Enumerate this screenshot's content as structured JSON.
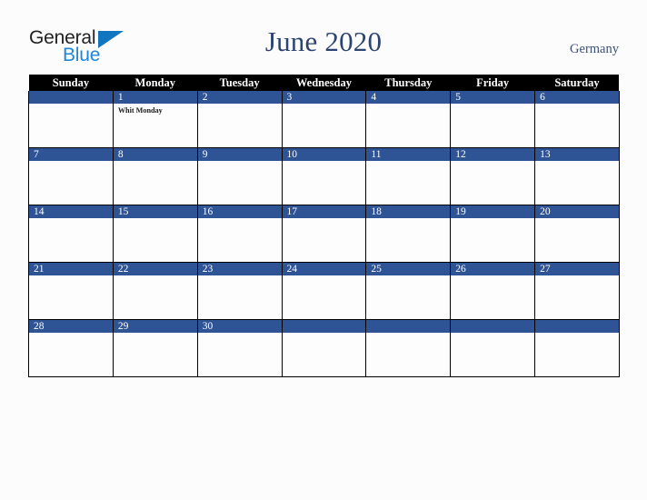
{
  "brand": {
    "word_one": "General",
    "word_two": "Blue"
  },
  "header": {
    "title": "June 2020",
    "country": "Germany"
  },
  "calendar": {
    "weekday_headers": [
      "Sunday",
      "Monday",
      "Tuesday",
      "Wednesday",
      "Thursday",
      "Friday",
      "Saturday"
    ],
    "colors": {
      "header_bar": "#000000",
      "date_bar": "#2f5496",
      "title": "#2d4470",
      "country": "#3c5077",
      "brand_blue": "#1f87d8",
      "page_background": "#fcfcfc",
      "cell_background": "#fdfdfd"
    },
    "weeks": [
      [
        {
          "date": "",
          "events": []
        },
        {
          "date": "1",
          "events": [
            "Whit Monday"
          ]
        },
        {
          "date": "2",
          "events": []
        },
        {
          "date": "3",
          "events": []
        },
        {
          "date": "4",
          "events": []
        },
        {
          "date": "5",
          "events": []
        },
        {
          "date": "6",
          "events": []
        }
      ],
      [
        {
          "date": "7",
          "events": []
        },
        {
          "date": "8",
          "events": []
        },
        {
          "date": "9",
          "events": []
        },
        {
          "date": "10",
          "events": []
        },
        {
          "date": "11",
          "events": []
        },
        {
          "date": "12",
          "events": []
        },
        {
          "date": "13",
          "events": []
        }
      ],
      [
        {
          "date": "14",
          "events": []
        },
        {
          "date": "15",
          "events": []
        },
        {
          "date": "16",
          "events": []
        },
        {
          "date": "17",
          "events": []
        },
        {
          "date": "18",
          "events": []
        },
        {
          "date": "19",
          "events": []
        },
        {
          "date": "20",
          "events": []
        }
      ],
      [
        {
          "date": "21",
          "events": []
        },
        {
          "date": "22",
          "events": []
        },
        {
          "date": "23",
          "events": []
        },
        {
          "date": "24",
          "events": []
        },
        {
          "date": "25",
          "events": []
        },
        {
          "date": "26",
          "events": []
        },
        {
          "date": "27",
          "events": []
        }
      ],
      [
        {
          "date": "28",
          "events": []
        },
        {
          "date": "29",
          "events": []
        },
        {
          "date": "30",
          "events": []
        },
        {
          "date": "",
          "events": []
        },
        {
          "date": "",
          "events": []
        },
        {
          "date": "",
          "events": []
        },
        {
          "date": "",
          "events": []
        }
      ]
    ]
  }
}
